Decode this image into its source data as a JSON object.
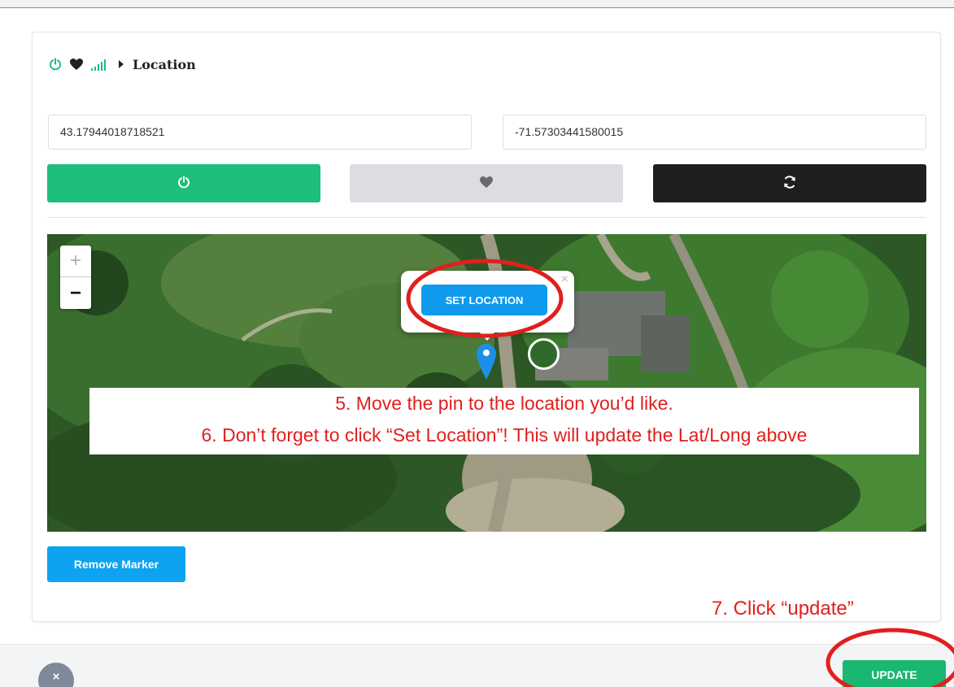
{
  "breadcrumb": {
    "label": "Location"
  },
  "coords": {
    "latitude": "43.17944018718521",
    "longitude": "-71.57303441580015"
  },
  "map": {
    "zoom_in": "+",
    "zoom_out": "−",
    "popup": {
      "set_location_label": "SET LOCATION",
      "close_label": "×"
    }
  },
  "instructions": {
    "step5": "5. Move the pin to the location you’d like.",
    "step6": "6. Don’t forget to click “Set Location”! This will update the Lat/Long above",
    "step7": "7. Click “update”"
  },
  "buttons": {
    "remove_marker": "Remove Marker",
    "update": "UPDATE",
    "close": "×"
  },
  "icons": {
    "breadcrumb": [
      "power-icon",
      "heart-icon",
      "signal-icon",
      "caret-right-icon"
    ],
    "actions": [
      "power-icon",
      "heart-icon",
      "refresh-icon"
    ]
  },
  "colors": {
    "green": "#1dbe7a",
    "blue": "#0f9aee",
    "dark": "#1d1e20",
    "annotation_red": "#e0201e"
  }
}
